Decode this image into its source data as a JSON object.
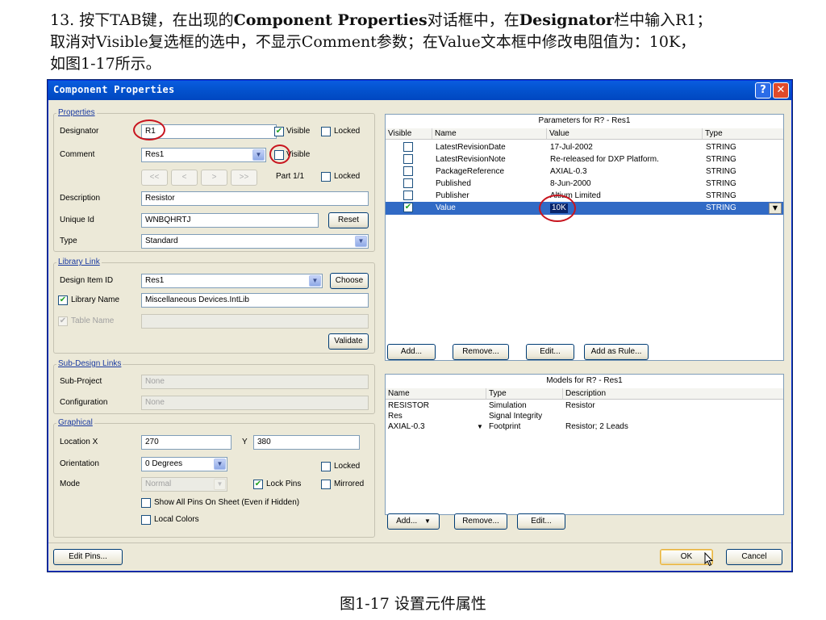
{
  "instruction": {
    "line1_a": "13. 按下TAB键，在出现的",
    "line1_b": "Component Properties",
    "line1_c": "对话框中，在",
    "line1_d": "Designator",
    "line1_e": "栏中输入R1；",
    "line2": "取消对Visible复选框的选中，不显示Comment参数；在Value文本框中修改电阻值为：10K，",
    "line3": "如图1-17所示。"
  },
  "caption": "图1-17 设置元件属性",
  "window": {
    "title": "Component Properties",
    "help": "?",
    "close": "✕"
  },
  "properties": {
    "group_title": "Properties",
    "designator_label": "Designator",
    "designator_value": "R1",
    "visible_label": "Visible",
    "locked_label": "Locked",
    "comment_label": "Comment",
    "comment_value": "Res1",
    "nav_first": "<<",
    "nav_prev": "<",
    "nav_next": ">",
    "nav_last": ">>",
    "part_label": "Part 1/1",
    "description_label": "Description",
    "description_value": "Resistor",
    "unique_id_label": "Unique Id",
    "unique_id_value": "WNBQHRTJ",
    "reset_label": "Reset",
    "type_label": "Type",
    "type_value": "Standard"
  },
  "library_link": {
    "group_title": "Library Link",
    "design_item_label": "Design Item ID",
    "design_item_value": "Res1",
    "choose_label": "Choose",
    "library_name_label": "Library Name",
    "library_name_value": "Miscellaneous Devices.IntLib",
    "table_name_label": "Table Name",
    "validate_label": "Validate"
  },
  "sub_design": {
    "group_title": "Sub-Design Links",
    "sub_project_label": "Sub-Project",
    "sub_project_value": "None",
    "configuration_label": "Configuration",
    "configuration_value": "None"
  },
  "graphical": {
    "group_title": "Graphical",
    "location_label": "Location  X",
    "location_x": "270",
    "y_label": "Y",
    "location_y": "380",
    "orientation_label": "Orientation",
    "orientation_value": "0 Degrees",
    "locked_label": "Locked",
    "mode_label": "Mode",
    "mode_value": "Normal",
    "lock_pins_label": "Lock Pins",
    "mirrored_label": "Mirrored",
    "show_all_pins_label": "Show All Pins On Sheet (Even if Hidden)",
    "local_colors_label": "Local Colors"
  },
  "parameters": {
    "title": "Parameters for R? - Res1",
    "col_visible": "Visible",
    "col_name": "Name",
    "col_value": "Value",
    "col_type": "Type",
    "rows": [
      {
        "name": "LatestRevisionDate",
        "value": "17-Jul-2002",
        "type": "STRING"
      },
      {
        "name": "LatestRevisionNote",
        "value": "Re-released for DXP Platform.",
        "type": "STRING"
      },
      {
        "name": "PackageReference",
        "value": "AXIAL-0.3",
        "type": "STRING"
      },
      {
        "name": "Published",
        "value": "8-Jun-2000",
        "type": "STRING"
      },
      {
        "name": "Publisher",
        "value": "Altium Limited",
        "type": "STRING"
      },
      {
        "name": "Value",
        "value": "10K",
        "type": "STRING"
      }
    ],
    "add_label": "Add...",
    "remove_label": "Remove...",
    "edit_label": "Edit...",
    "add_as_rule_label": "Add as Rule..."
  },
  "models": {
    "title": "Models for R? - Res1",
    "col_name": "Name",
    "col_type": "Type",
    "col_description": "Description",
    "rows": [
      {
        "name": "RESISTOR",
        "type": "Simulation",
        "description": "Resistor"
      },
      {
        "name": "Res",
        "type": "Signal Integrity",
        "description": ""
      },
      {
        "name": "AXIAL-0.3",
        "type": "Footprint",
        "description": "Resistor; 2 Leads"
      }
    ],
    "add_label": "Add...",
    "remove_label": "Remove...",
    "edit_label": "Edit..."
  },
  "footer": {
    "edit_pins_label": "Edit Pins...",
    "ok_label": "OK",
    "cancel_label": "Cancel"
  }
}
